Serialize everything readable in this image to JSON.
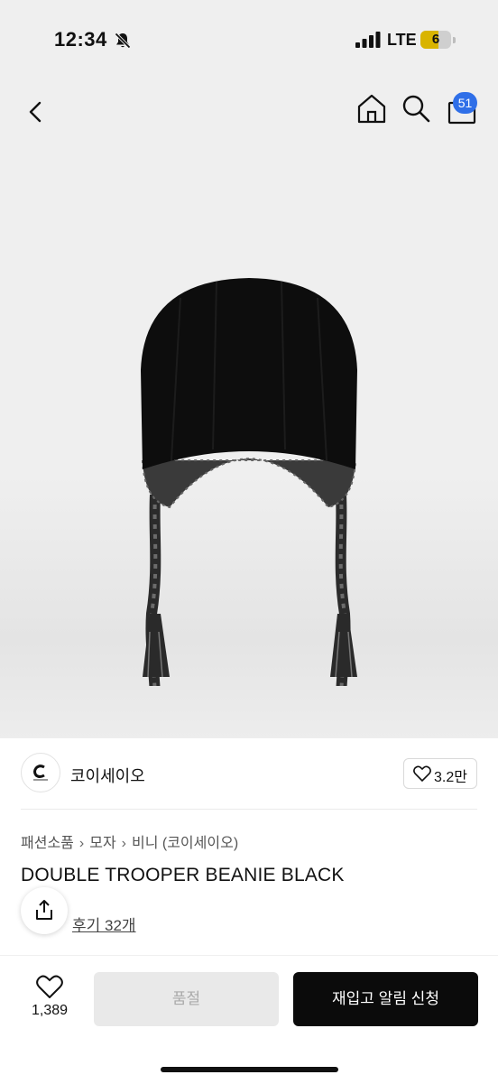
{
  "status_bar": {
    "time": "12:34",
    "carrier": "LTE",
    "battery": "6",
    "battery_level": 0.6,
    "battery_color": "#d9b400"
  },
  "nav": {
    "cart_count": "51",
    "badge_color": "#2f6fe8",
    "icons": [
      "chevron-left-icon",
      "home-icon",
      "search-icon",
      "shopping-bag-icon"
    ]
  },
  "seller": {
    "name": "코이세이오",
    "like_count": "3.2만"
  },
  "breadcrumb": [
    "패션소품",
    "모자",
    "비니 (코이세이오)"
  ],
  "product": {
    "title": "DOUBLE TROOPER BEANIE BLACK",
    "review_link": "후기 32개"
  },
  "bottom_bar": {
    "wish_count": "1,389",
    "soldout_label": "품절",
    "restock_label": "재입고 알림 신청"
  }
}
